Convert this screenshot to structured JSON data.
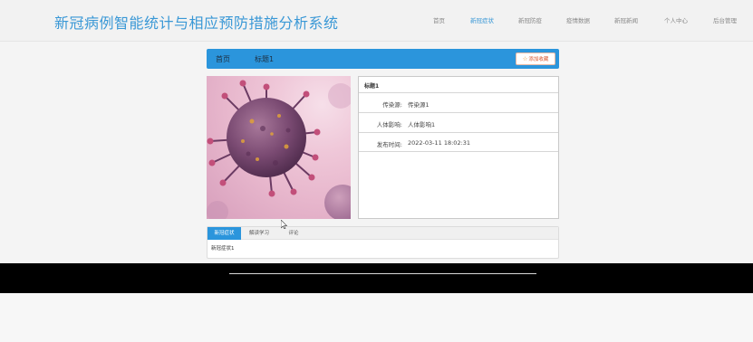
{
  "header": {
    "site_title": "新冠病例智能统计与相应预防措施分析系统",
    "nav": [
      {
        "label": "首页",
        "active": false
      },
      {
        "label": "新冠症状",
        "active": true
      },
      {
        "label": "新冠防疫",
        "active": false
      },
      {
        "label": "疫情数据",
        "active": false
      },
      {
        "label": "新冠新闻",
        "active": false
      },
      {
        "label": "个人中心",
        "active": false
      },
      {
        "label": "后台管理",
        "active": false
      }
    ]
  },
  "breadcrumb": {
    "home": "首页",
    "current": "标题1",
    "favorite_button": "添加收藏"
  },
  "detail": {
    "title": "标题1",
    "rows": [
      {
        "label": "传染源:",
        "value": "传染源1"
      },
      {
        "label": "人体影响:",
        "value": "人体影响1"
      },
      {
        "label": "发布时间:",
        "value": "2022-03-11 18:02:31"
      }
    ]
  },
  "tabs": {
    "items": [
      {
        "label": "新冠症状",
        "active": true
      },
      {
        "label": "解读学习",
        "active": false
      },
      {
        "label": "评论",
        "active": false
      }
    ],
    "content": "新冠症状1"
  },
  "colors": {
    "accent": "#2b95dc",
    "title": "#3a98d6",
    "favorite": "#d9532a"
  }
}
